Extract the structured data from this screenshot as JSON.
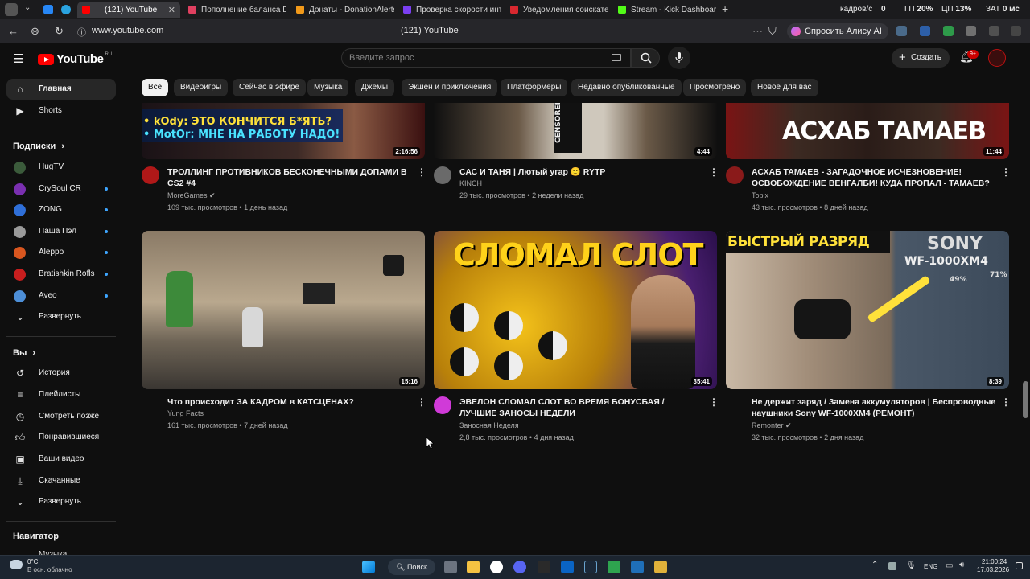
{
  "browser": {
    "tabs": [
      {
        "label": "(121) YouTube",
        "color": "#ff0000",
        "active": true
      },
      {
        "label": "Пополнение баланса Dis",
        "color": "#e04060"
      },
      {
        "label": "Донаты - DonationAlerts",
        "color": "#f29a1a"
      },
      {
        "label": "Проверка скорости инте",
        "color": "#7b3ff2"
      },
      {
        "label": "Уведомления соискател",
        "color": "#d9282f"
      },
      {
        "label": "Stream - Kick Dashboard",
        "color": "#53fc18"
      }
    ],
    "stats": {
      "fps_label": "кадров/с",
      "fps_value": "0",
      "gpu_label": "ГП",
      "gpu_value": "20%",
      "cpu_label": "ЦП",
      "cpu_value": "13%",
      "lat_label": "ЗАТ",
      "lat_value": "0 мс"
    },
    "url": "www.youtube.com",
    "page_title": "(121) YouTube",
    "alice_label": "Спросить Алису AI"
  },
  "youtube": {
    "logo_text": "YouTube",
    "logo_region": "RU",
    "search_placeholder": "Введите запрос",
    "create_label": "Создать",
    "notif_count": "9+",
    "chips": [
      "Все",
      "Видеоигры",
      "Сейчас в эфире",
      "Музыка",
      "Джемы",
      "Экшен и приключения",
      "Платформеры",
      "Недавно опубликованные",
      "Просмотрено",
      "Новое для вас"
    ]
  },
  "sidebar": {
    "main": [
      {
        "label": "Главная",
        "icon": "home-icon"
      },
      {
        "label": "Shorts",
        "icon": "shorts-icon"
      }
    ],
    "subs_title": "Подписки",
    "subs": [
      {
        "label": "HugTV",
        "color": "#3b5b3b",
        "dot": false
      },
      {
        "label": "CrySoul CR",
        "color": "#7a2fb0",
        "dot": true
      },
      {
        "label": "ZONG",
        "color": "#2f6fd8",
        "dot": true
      },
      {
        "label": "Паша Пэл",
        "color": "#9a9a9a",
        "dot": true
      },
      {
        "label": "Aleppo",
        "color": "#d9561f",
        "dot": true
      },
      {
        "label": "Bratishkin Rofls",
        "color": "#c81e1e",
        "dot": true
      },
      {
        "label": "Aveo",
        "color": "#4d8fd8",
        "dot": true
      }
    ],
    "subs_expand": "Развернуть",
    "you_title": "Вы",
    "you": [
      {
        "label": "История",
        "icon": "history-icon"
      },
      {
        "label": "Плейлисты",
        "icon": "playlists-icon"
      },
      {
        "label": "Смотреть позже",
        "icon": "watch-later-icon"
      },
      {
        "label": "Понравившиеся",
        "icon": "like-icon"
      },
      {
        "label": "Ваши видео",
        "icon": "your-videos-icon"
      },
      {
        "label": "Скачанные",
        "icon": "download-icon"
      },
      {
        "label": "Развернуть",
        "icon": "chevron-down-icon"
      }
    ],
    "nav_title": "Навигатор",
    "nav_partial": "Музыка"
  },
  "videos": [
    {
      "title": "ТРОЛЛИНГ ПРОТИВНИКОВ БЕСКОНЕЧНЫМИ ДОПАМИ В CS2 #4",
      "channel": "MoreGames",
      "verified": true,
      "views": "109 тыс. просмотров",
      "age": "1 день назад",
      "duration": "2:16:56",
      "thumb_text": [
        "• kOdy: ЭТО КОНЧИТСЯ Б*ЯТЬ?",
        "• MotOr: МНЕ НА РАБОТУ НАДО!"
      ],
      "avatar_color": "#b01818"
    },
    {
      "title": "САС И ТАНЯ | Лютый угар 🙂 RYTP",
      "channel": "KINCH",
      "verified": false,
      "views": "29 тыс. просмотров",
      "age": "2 недели назад",
      "duration": "4:44",
      "thumb_text": [
        "CENSORED"
      ],
      "avatar_color": "#6a6a6a"
    },
    {
      "title": "АСХАБ ТАМАЕВ - ЗАГАДОЧНОЕ ИСЧЕЗНОВЕНИЕ! ОСВОБОЖДЕНИЕ ВЕНГАЛБИ! КУДА ПРОПАЛ - ТАМАЕВ?",
      "channel": "Topix",
      "verified": false,
      "views": "43 тыс. просмотров",
      "age": "8 дней назад",
      "duration": "11:44",
      "thumb_text": [
        "АСХАБ ТАМАЕВ"
      ],
      "avatar_color": "#8a1a1a"
    },
    {
      "title": "Что происходит ЗА КАДРОМ в КАТСЦЕНАХ?",
      "channel": "Yung Facts",
      "verified": false,
      "views": "161 тыс. просмотров",
      "age": "7 дней назад",
      "duration": "15:16",
      "thumb_text": [],
      "avatar_color": "#444444"
    },
    {
      "title": "ЭВЕЛОН СЛОМАЛ СЛОТ ВО ВРЕМЯ БОНУСБАЯ / ЛУЧШИЕ ЗАНОСЫ НЕДЕЛИ",
      "channel": "Заносная Неделя",
      "verified": false,
      "views": "2,8 тыс. просмотров",
      "age": "4 дня назад",
      "duration": "35:41",
      "thumb_text": [
        "СЛОМАЛ СЛОТ"
      ],
      "avatar_color": "#d03ad8"
    },
    {
      "title": "Не держит заряд / Замена аккумуляторов | Беспроводные наушники Sony WF-1000XM4 (РЕМОНТ)",
      "channel": "Remonter",
      "verified": true,
      "views": "32 тыс. просмотров",
      "age": "2 дня назад",
      "duration": "8:39",
      "thumb_text": [
        "БЫСТРЫЙ РАЗРЯД",
        "SONY",
        "WF-1000XM4",
        "49%",
        "71%"
      ],
      "avatar_color": "#555555"
    }
  ],
  "taskbar": {
    "weather_temp": "0°C",
    "weather_desc": "В осн. облачно",
    "search_label": "Поиск",
    "lang": "ENG",
    "time": "21:00:24",
    "date": "17.03.2026"
  }
}
